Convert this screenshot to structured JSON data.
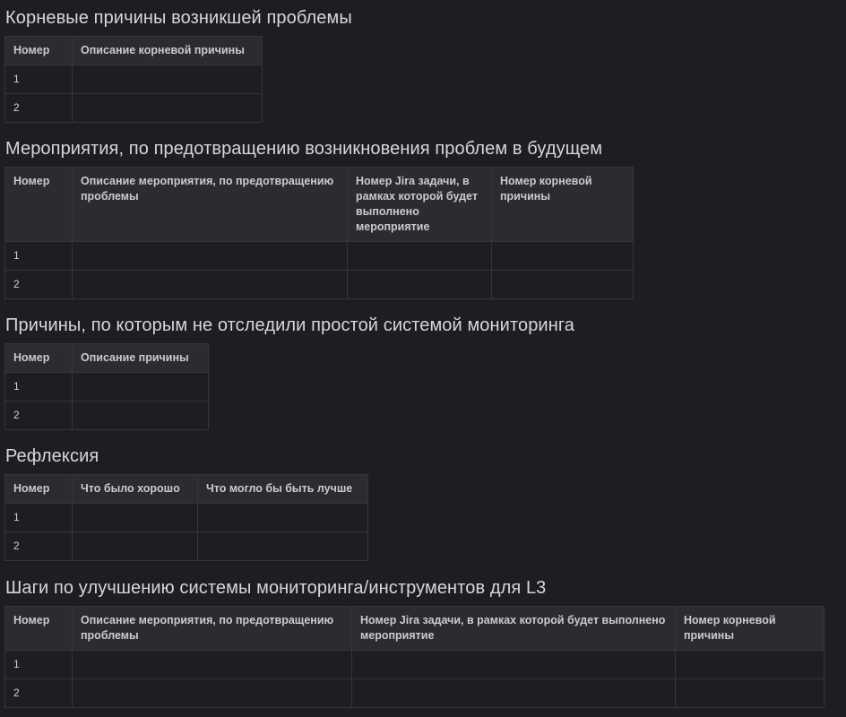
{
  "sections": [
    {
      "title": "Корневые причины возникшей проблемы",
      "headers": [
        "Номер",
        "Описание корневой причины"
      ],
      "rows": [
        [
          "1",
          ""
        ],
        [
          "2",
          ""
        ]
      ]
    },
    {
      "title": "Мероприятия, по предотвращению возникновения проблем в будущем",
      "headers": [
        "Номер",
        "Описание мероприятия,  по предотвращению проблемы",
        "Номер Jira задачи, в рамках которой будет выполнено мероприятие",
        "Номер корневой причины"
      ],
      "rows": [
        [
          "1",
          "",
          "",
          ""
        ],
        [
          "2",
          "",
          "",
          ""
        ]
      ]
    },
    {
      "title": "Причины, по которым не отследили простой системой мониторинга",
      "headers": [
        "Номер",
        "Описание причины"
      ],
      "rows": [
        [
          "1",
          ""
        ],
        [
          "2",
          ""
        ]
      ]
    },
    {
      "title": "Рефлексия",
      "headers": [
        "Номер",
        "Что было хорошо",
        "Что могло бы быть лучше"
      ],
      "rows": [
        [
          "1",
          "",
          ""
        ],
        [
          "2",
          "",
          ""
        ]
      ]
    },
    {
      "title": "Шаги по улучшению системы мониторинга/инструментов для L3",
      "headers": [
        "Номер",
        "Описание мероприятия, по предотвращению проблемы",
        "Номер Jira задачи, в рамках которой будет выполнено мероприятие",
        "Номер корневой причины"
      ],
      "rows": [
        [
          "1",
          "",
          "",
          ""
        ],
        [
          "2",
          "",
          "",
          ""
        ]
      ]
    }
  ]
}
